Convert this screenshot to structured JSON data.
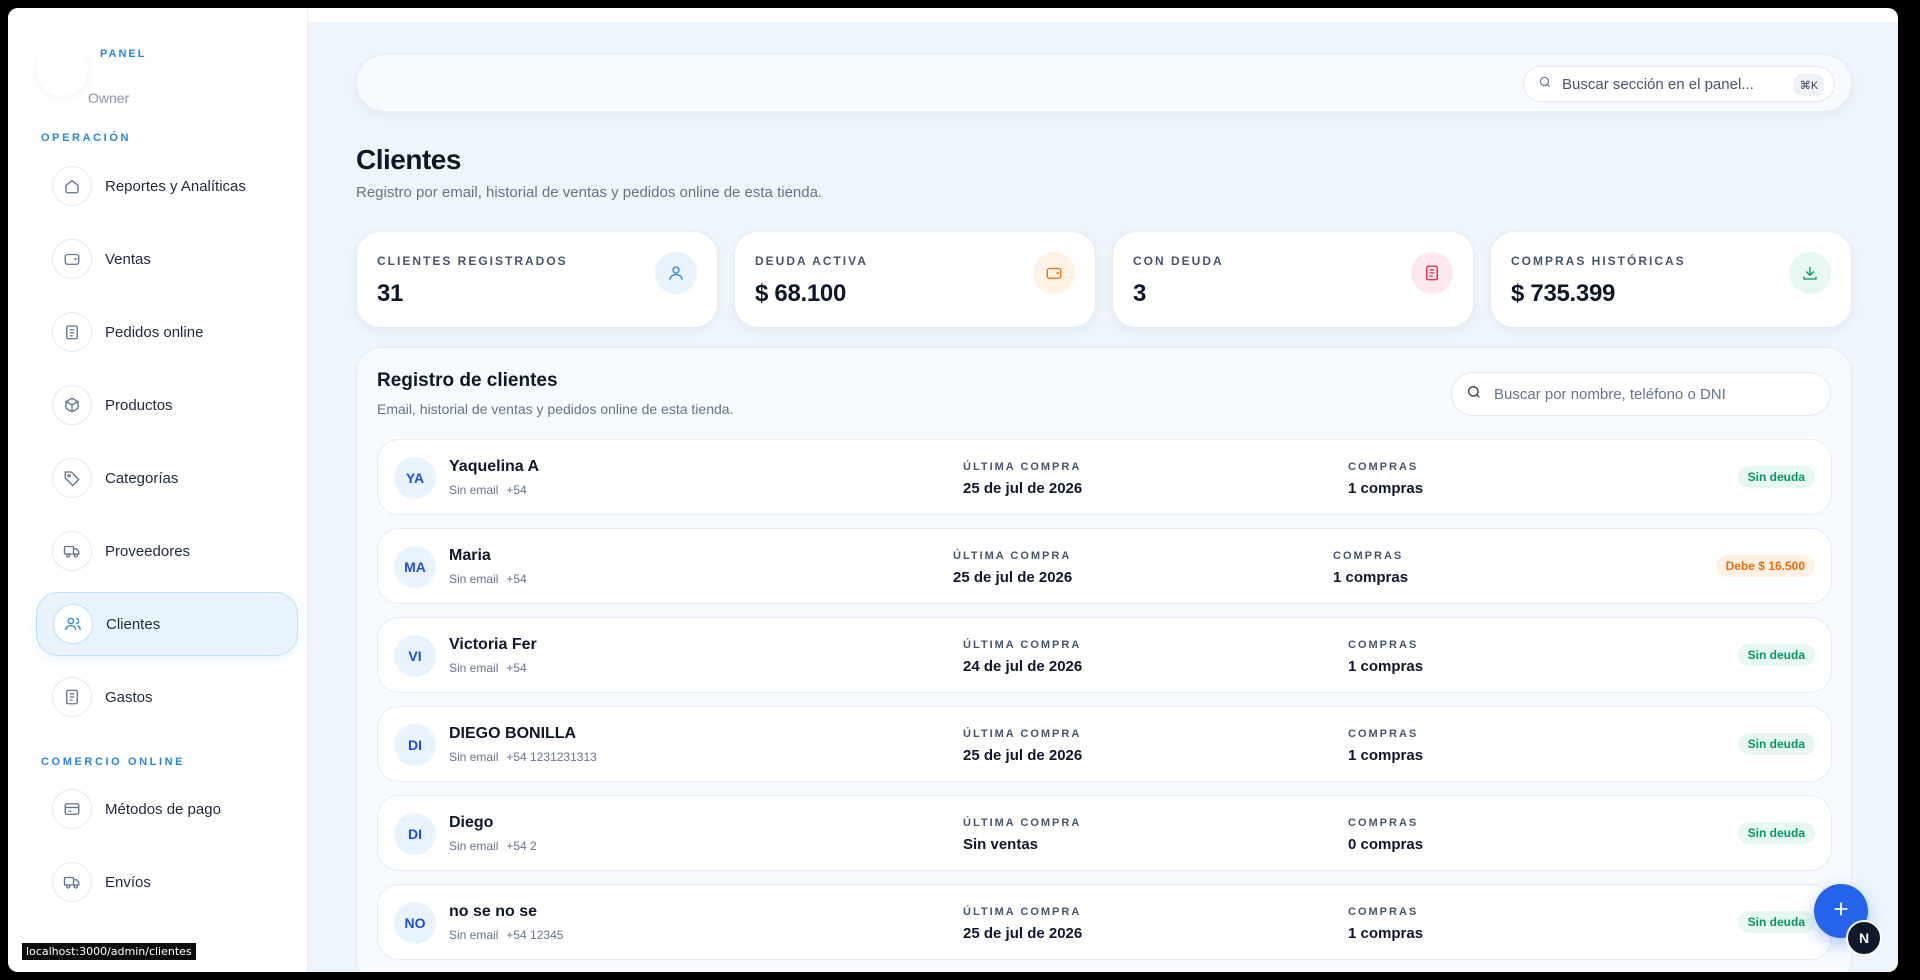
{
  "brand": {
    "kicker": "PANEL",
    "role": "Owner"
  },
  "sidebar": {
    "section_operacion": "OPERACIÓN",
    "section_comercio": "COMERCIO ONLINE",
    "items": [
      {
        "label": "Reportes y Analíticas",
        "icon": "home-icon"
      },
      {
        "label": "Ventas",
        "icon": "wallet-icon"
      },
      {
        "label": "Pedidos online",
        "icon": "clipboard-icon"
      },
      {
        "label": "Productos",
        "icon": "box-icon"
      },
      {
        "label": "Categorías",
        "icon": "tag-icon"
      },
      {
        "label": "Proveedores",
        "icon": "truck-icon"
      },
      {
        "label": "Clientes",
        "icon": "users-icon",
        "active": true
      },
      {
        "label": "Gastos",
        "icon": "receipt-icon"
      },
      {
        "label": "Métodos de pago",
        "icon": "credit-card-icon"
      },
      {
        "label": "Envíos",
        "icon": "truck-icon"
      }
    ]
  },
  "status_url": "localhost:3000/admin/clientes",
  "topbar": {
    "search_placeholder": "Buscar sección en el panel...",
    "shortcut": "⌘K"
  },
  "page": {
    "title": "Clientes",
    "subtitle": "Registro por email, historial de ventas y pedidos online de esta tienda."
  },
  "stats": [
    {
      "label": "CLIENTES REGISTRADOS",
      "value": "31",
      "icon": "user-icon",
      "color": "#2a86d9",
      "bg": "#e8f3fd"
    },
    {
      "label": "DEUDA ACTIVA",
      "value": "$ 68.100",
      "icon": "wallet-icon",
      "color": "#ea6c0a",
      "bg": "#fff2e5"
    },
    {
      "label": "CON DEUDA",
      "value": "3",
      "icon": "receipt-icon",
      "color": "#e11d48",
      "bg": "#fde8ee"
    },
    {
      "label": "COMPRAS HISTÓRICAS",
      "value": "$ 735.399",
      "icon": "download-icon",
      "color": "#059669",
      "bg": "#e6f8f0"
    }
  ],
  "panel": {
    "title": "Registro de clientes",
    "subtitle": "Email, historial de ventas y pedidos online de esta tienda.",
    "search_placeholder": "Buscar por nombre, teléfono o DNI",
    "col_last": "ÚLTIMA COMPRA",
    "col_purchases": "COMPRAS"
  },
  "clients": [
    {
      "initials": "YA",
      "name": "Yaquelina A",
      "email": "Sin email",
      "phone": "+54",
      "last": "25 de jul de 2026",
      "purchases": "1 compras",
      "status": "Sin deuda",
      "debt": false
    },
    {
      "initials": "MA",
      "name": "Maria",
      "email": "Sin email",
      "phone": "+54",
      "last": "25 de jul de 2026",
      "purchases": "1 compras",
      "status": "Debe $ 16.500",
      "debt": true
    },
    {
      "initials": "VI",
      "name": "Victoria Fer",
      "email": "Sin email",
      "phone": "+54",
      "last": "24 de jul de 2026",
      "purchases": "1 compras",
      "status": "Sin deuda",
      "debt": false
    },
    {
      "initials": "DI",
      "name": "DIEGO BONILLA",
      "email": "Sin email",
      "phone": "+54 1231231313",
      "last": "25 de jul de 2026",
      "purchases": "1 compras",
      "status": "Sin deuda",
      "debt": false
    },
    {
      "initials": "DI",
      "name": "Diego",
      "email": "Sin email",
      "phone": "+54 2",
      "last": "Sin ventas",
      "purchases": "0 compras",
      "status": "Sin deuda",
      "debt": false
    },
    {
      "initials": "NO",
      "name": "no se no se",
      "email": "Sin email",
      "phone": "+54 12345",
      "last": "25 de jul de 2026",
      "purchases": "1 compras",
      "status": "Sin deuda",
      "debt": false
    }
  ],
  "avatar_badge": "N"
}
